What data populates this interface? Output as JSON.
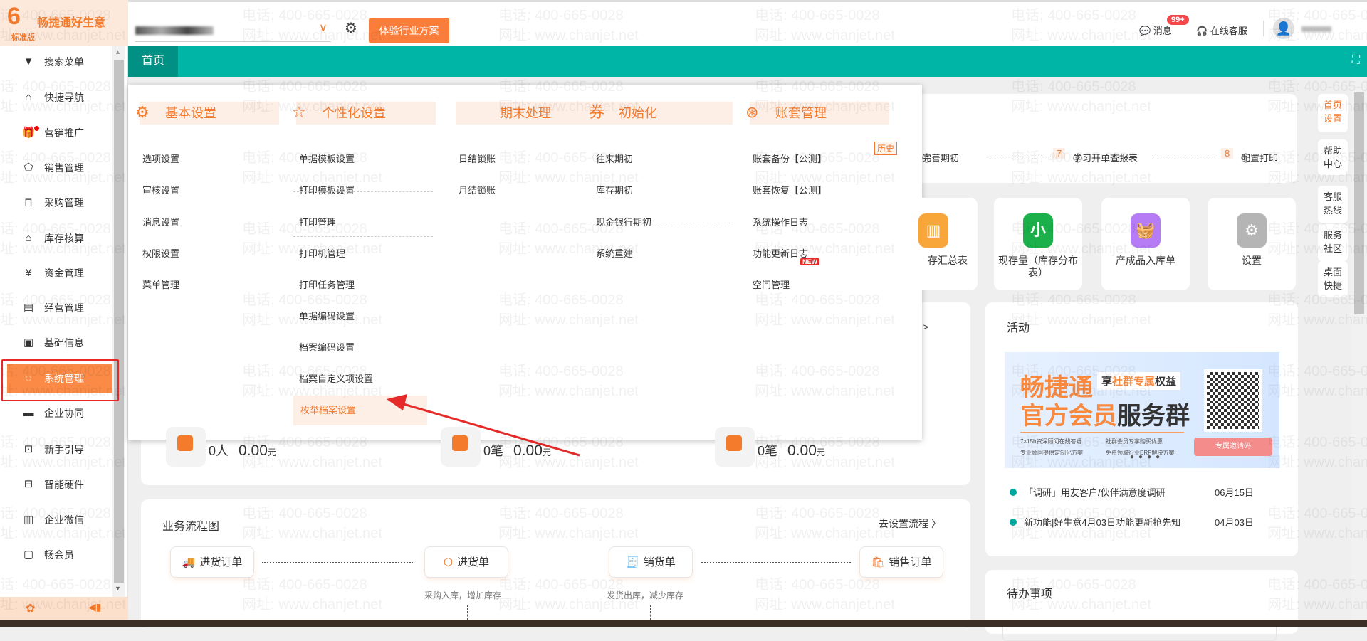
{
  "watermark": {
    "phone": "电话: 400-665-0028",
    "site": "网址: www.chanjet.net"
  },
  "logo": {
    "mark": "6",
    "brand": "畅捷通好生意",
    "edition": "标准版"
  },
  "header": {
    "try_button": "体验行业方案",
    "messages": "消息",
    "badge": "99+",
    "service": "在线客服"
  },
  "tabs": {
    "home": "首页"
  },
  "sidebar": {
    "items": [
      {
        "label": "搜索菜单",
        "icon": "diamond-icon"
      },
      {
        "label": "快捷导航",
        "icon": "home-icon"
      },
      {
        "label": "营销推广",
        "icon": "gift-icon"
      },
      {
        "label": "销售管理",
        "icon": "sales-icon"
      },
      {
        "label": "采购管理",
        "icon": "bag-icon"
      },
      {
        "label": "库存核算",
        "icon": "warehouse-icon"
      },
      {
        "label": "资金管理",
        "icon": "money-icon"
      },
      {
        "label": "经营管理",
        "icon": "clipboard-icon"
      },
      {
        "label": "基础信息",
        "icon": "id-card-icon"
      },
      {
        "label": "系统管理",
        "icon": "system-icon",
        "active": true
      },
      {
        "label": "企业协同",
        "icon": "monitor-icon"
      },
      {
        "label": "新手引导",
        "icon": "new-icon"
      },
      {
        "label": "智能硬件",
        "icon": "ticket-icon"
      },
      {
        "label": "企业微信",
        "icon": "wechat-icon"
      },
      {
        "label": "畅会员",
        "icon": "member-icon"
      }
    ]
  },
  "menu": {
    "columns": [
      {
        "title": "基本设置",
        "items": [
          "选项设置",
          "审核设置",
          "消息设置",
          "权限设置",
          "菜单管理"
        ]
      },
      {
        "title": "个性化设置",
        "items": [
          "单据模板设置",
          "打印模板设置",
          "打印管理",
          "打印机管理",
          "打印任务管理",
          "单据编码设置",
          "档案编码设置",
          "档案自定义项设置",
          "枚举档案设置"
        ]
      },
      {
        "title": "期末处理",
        "items": [
          "日结锁账",
          "月结锁账"
        ]
      },
      {
        "title": "初始化",
        "items": [
          "往来期初",
          "库存期初",
          "现金银行期初",
          "系统重建"
        ]
      },
      {
        "title": "账套管理",
        "items": [
          "账套备份【公测】",
          "账套恢复【公测】",
          "系统操作日志",
          "功能更新日志",
          "空间管理"
        ]
      }
    ],
    "history_tag": "历史",
    "new_tag": "NEW",
    "selected": "枚举档案设置"
  },
  "steps": {
    "s6": "完善期初",
    "n7": "7",
    "s7": "学习开单查报表",
    "n8": "8",
    "s8": "配置打印"
  },
  "tiles": [
    {
      "label": "存汇总表",
      "color": "#f8a53a"
    },
    {
      "label": "现存量（库存分布表）",
      "color": "#1bb04a",
      "glyph": "小"
    },
    {
      "label": "产成品入库单",
      "color": "#b67cf6"
    },
    {
      "label": "设置",
      "color": "#b5b5b5"
    }
  ],
  "right_nav": [
    "首页设置",
    "帮助中心",
    "客服热线",
    "服务社区",
    "桌面快捷"
  ],
  "report_link": "报 >",
  "stats": [
    {
      "count": "0人",
      "amount": "0.00",
      "unit": "元"
    },
    {
      "count": "0笔",
      "amount": "0.00",
      "unit": "元"
    },
    {
      "count": "0笔",
      "amount": "0.00",
      "unit": "元"
    }
  ],
  "activity": {
    "title": "活动",
    "banner": {
      "brand": "畅捷通",
      "tag_pre": "享",
      "tag_hl": "社群专属",
      "tag_post": "权益",
      "line2a": "官方会员",
      "line2b": "服务群",
      "b1": "7×15h资深顾问在线答疑",
      "b2": "社群会员专享购买优惠",
      "b3": "专业顾问提供定制化方案",
      "b4": "免费领取行业ERP解决方案",
      "code_btn": "专属邀请码"
    },
    "items": [
      {
        "text": "「调研」用友客户/伙伴满意度调研",
        "date": "06月15日"
      },
      {
        "text": "新功能|好生意4月03日功能更新抢先知",
        "date": "04月03日"
      }
    ]
  },
  "todo": {
    "title": "待办事项"
  },
  "flow": {
    "title": "业务流程图",
    "link": "去设置流程 〉",
    "nodes": [
      "进货订单",
      "进货单",
      "销货单",
      "销售订单"
    ],
    "sub1": "采购入库，增加库存",
    "sub2": "发货出库，减少库存"
  },
  "colors": {
    "accent": "#fa7d3c",
    "teal": "#00b4a6"
  }
}
